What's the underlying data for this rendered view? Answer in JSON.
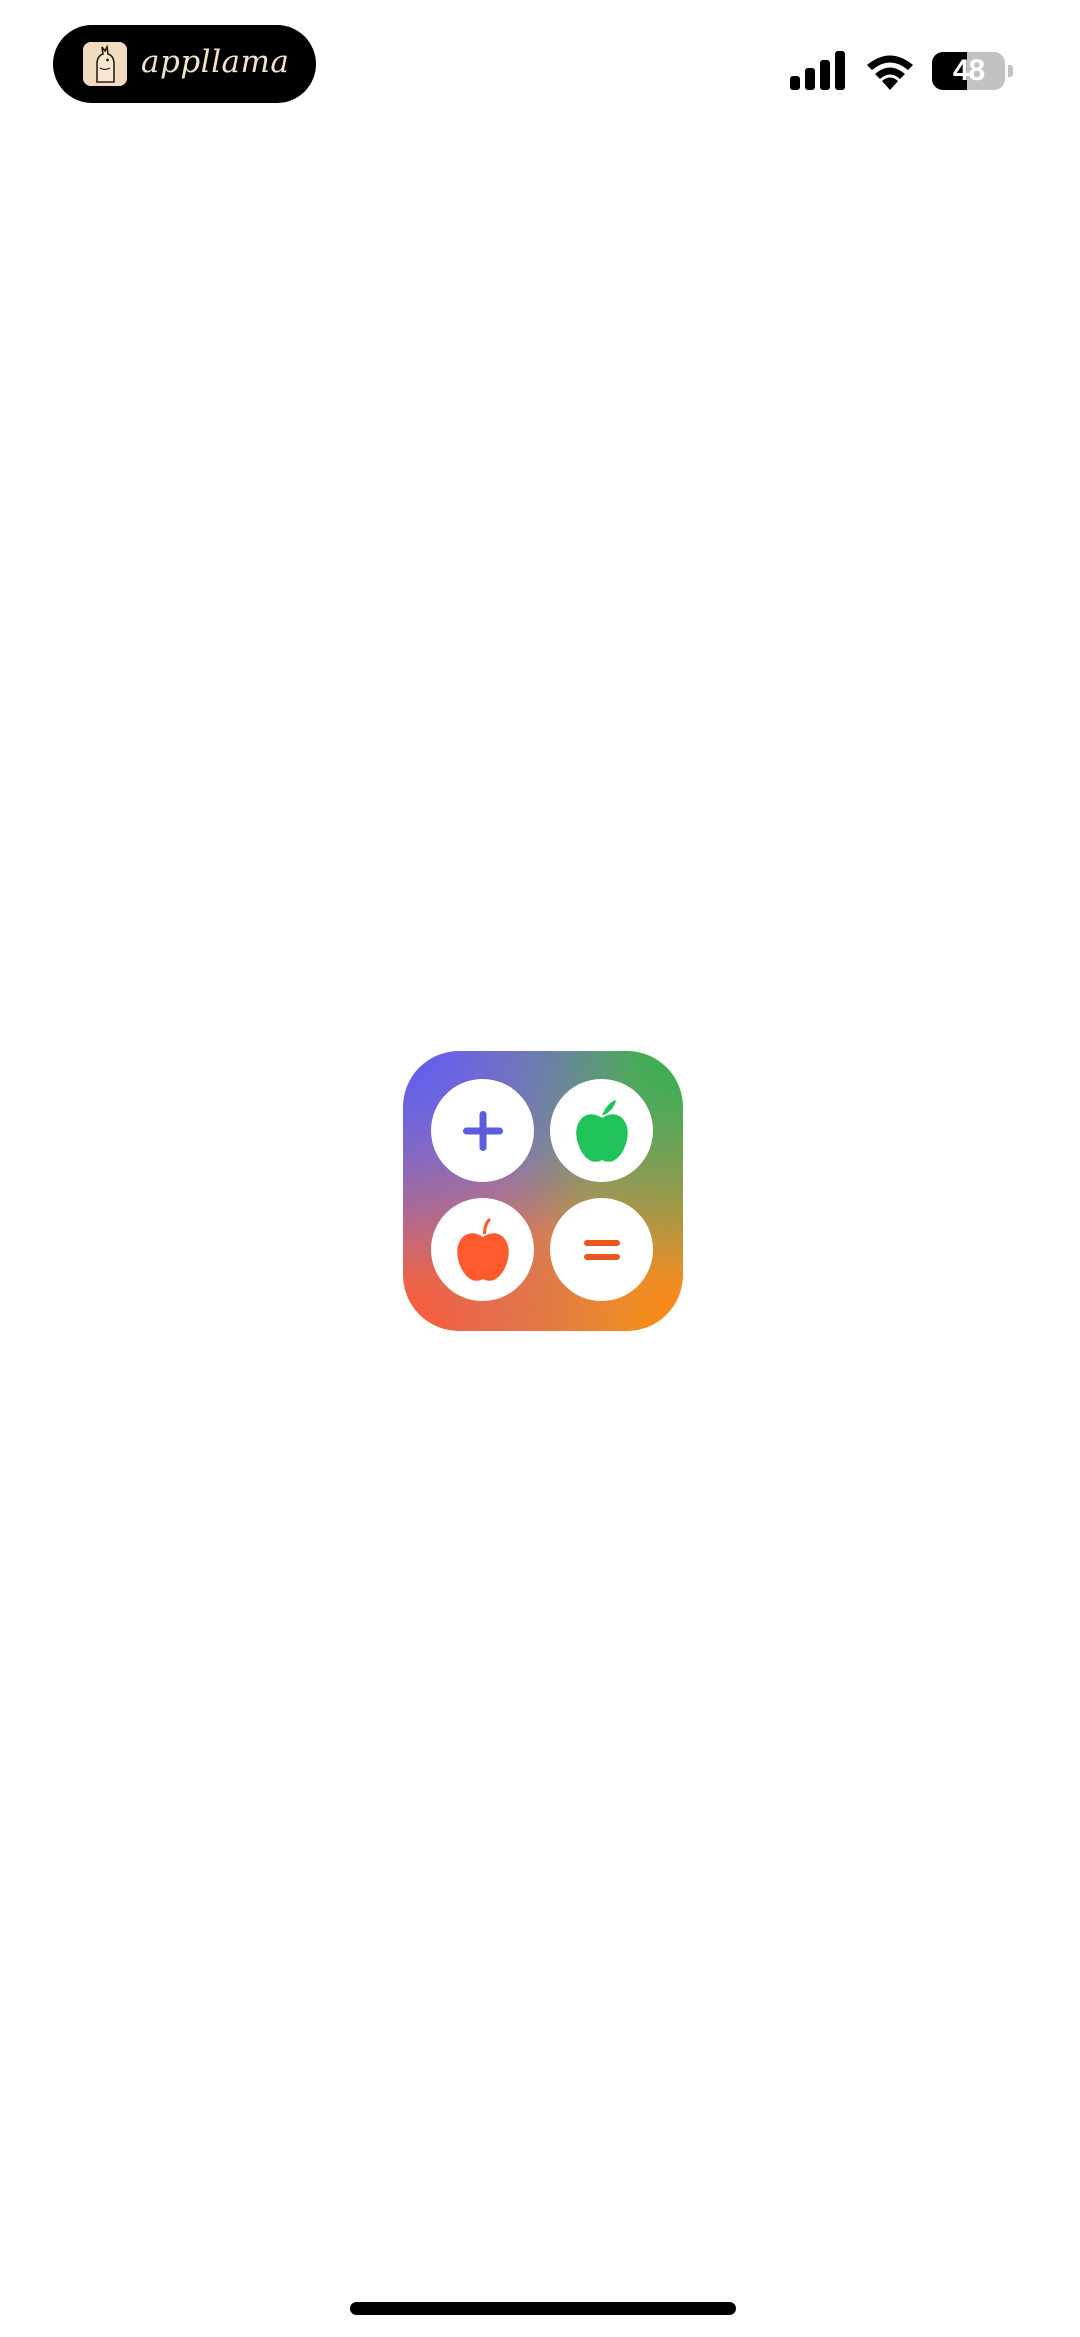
{
  "status_bar": {
    "brand_name": "appllama",
    "brand_logo_icon": "llama-icon",
    "signal_icon": "cellular-signal-icon",
    "wifi_icon": "wifi-icon",
    "battery_level": 48,
    "battery_text": "48"
  },
  "app_icon": {
    "buttons": [
      {
        "icon": "plus-icon",
        "color": "#5b5ce0"
      },
      {
        "icon": "apple-icon",
        "color": "#1fc35a"
      },
      {
        "icon": "apple-icon",
        "color": "#ff5a2e"
      },
      {
        "icon": "equals-icon",
        "color": "#e8581e"
      }
    ],
    "gradient_colors": [
      "#5b5cf0",
      "#2fb34a",
      "#ff5a36",
      "#ff8a10"
    ]
  }
}
